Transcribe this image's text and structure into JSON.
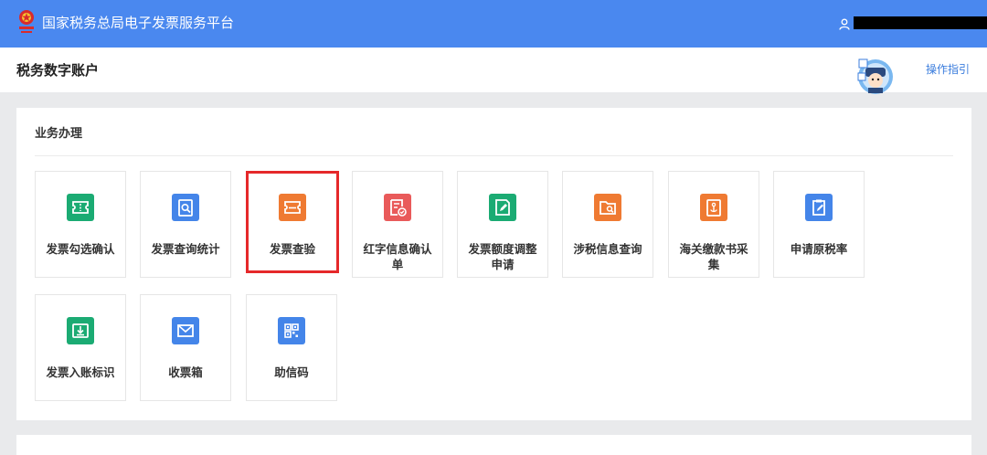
{
  "header": {
    "title": "国家税务总局电子发票服务平台",
    "user_icon": "user-icon"
  },
  "subheader": {
    "account_title": "税务数字账户",
    "guide_link": "操作指引"
  },
  "panel": {
    "title": "业务办理",
    "tiles": [
      {
        "label": "发票勾选确认",
        "icon": "ticket-icon",
        "color": "#1bab73"
      },
      {
        "label": "发票查询统计",
        "icon": "document-search-icon",
        "color": "#4485e9"
      },
      {
        "label": "发票查验",
        "icon": "ticket-check-icon",
        "color": "#ef7a32",
        "highlighted": true
      },
      {
        "label": "红字信息确认单",
        "icon": "document-check-icon",
        "color": "#e95a5a"
      },
      {
        "label": "发票额度调整申请",
        "icon": "document-edit-icon",
        "color": "#1bab73"
      },
      {
        "label": "涉税信息查询",
        "icon": "folder-search-icon",
        "color": "#ef7a32"
      },
      {
        "label": "海关缴款书采集",
        "icon": "anchor-document-icon",
        "color": "#ef7a32"
      },
      {
        "label": "申请原税率",
        "icon": "clipboard-edit-icon",
        "color": "#4485e9"
      },
      {
        "label": "发票入账标识",
        "icon": "inbox-download-icon",
        "color": "#1bab73"
      },
      {
        "label": "收票箱",
        "icon": "mail-icon",
        "color": "#4485e9"
      },
      {
        "label": "助信码",
        "icon": "qr-code-icon",
        "color": "#4485e9"
      }
    ]
  }
}
